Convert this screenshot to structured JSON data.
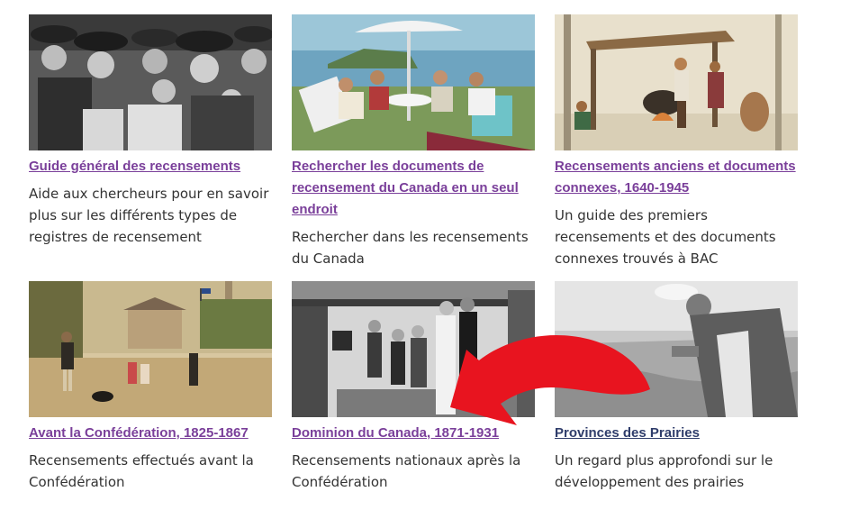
{
  "cards": [
    {
      "title": "Guide général des recensements",
      "description": "Aide aux chercheurs pour en savoir plus sur les différents types de registres de recensement"
    },
    {
      "title": "Rechercher les documents de recensement du Canada en un seul endroit",
      "description": "Rechercher dans les recensements du Canada"
    },
    {
      "title": "Recensements anciens et documents connexes, 1640-1945",
      "description": "Un guide des premiers recensements et des documents connexes trouvés à BAC"
    },
    {
      "title": "Avant la Confédération, 1825-1867",
      "description": "Recensements effectués avant la Confédération"
    },
    {
      "title": "Dominion du Canada, 1871-1931",
      "description": "Recensements nationaux après la Confédération"
    },
    {
      "title": "Provinces des Prairies",
      "description": "Un regard plus approfondi sur le développement des prairies"
    }
  ],
  "colors": {
    "link": "#7a3f9a",
    "link_visited": "#2f3d6b",
    "text": "#333333",
    "annotation_arrow": "#e8141f"
  }
}
